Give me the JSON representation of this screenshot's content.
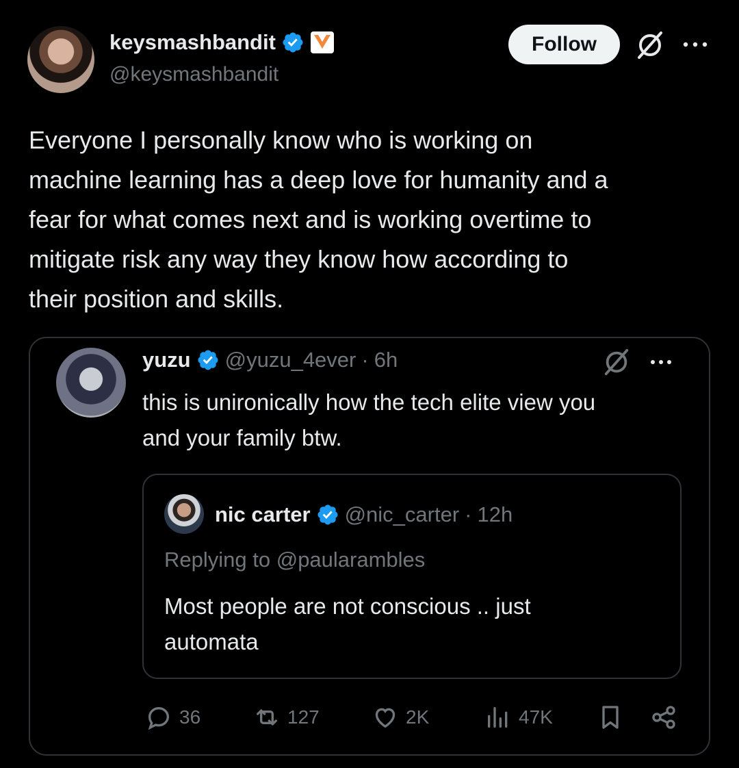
{
  "author": {
    "name": "keysmashbandit",
    "handle": "@keysmashbandit",
    "follow_label": "Follow"
  },
  "tweet": {
    "text": "Everyone I personally know who is working on\nmachine learning has a deep love for humanity and a\nfear for what comes next and is working overtime to\nmitigate risk any way they know how according to\ntheir position and skills."
  },
  "quote": {
    "name": "yuzu",
    "handle": "@yuzu_4ever",
    "separator": "·",
    "time": "6h",
    "text": "this is unironically how the tech elite view you\nand your family btw."
  },
  "inner_quote": {
    "name": "nic carter",
    "handle": "@nic_carter",
    "separator": "·",
    "time": "12h",
    "reply_prefix": "Replying to",
    "reply_handle": "@paularambles",
    "text": "Most people are not conscious .. just\nautomata"
  },
  "actions": {
    "replies": "36",
    "reposts": "127",
    "likes": "2K",
    "views": "47K"
  },
  "colors": {
    "background": "#000000",
    "text": "#e7e9ea",
    "muted": "#71767b",
    "verified": "#1d9bf0",
    "border": "#2f3336",
    "badge": "#f0883e"
  },
  "icons": [
    "verified-badge-icon",
    "brand-badge-icon",
    "grok-icon",
    "more-icon",
    "reply-icon",
    "repost-icon",
    "like-icon",
    "views-icon",
    "bookmark-icon",
    "share-icon"
  ]
}
